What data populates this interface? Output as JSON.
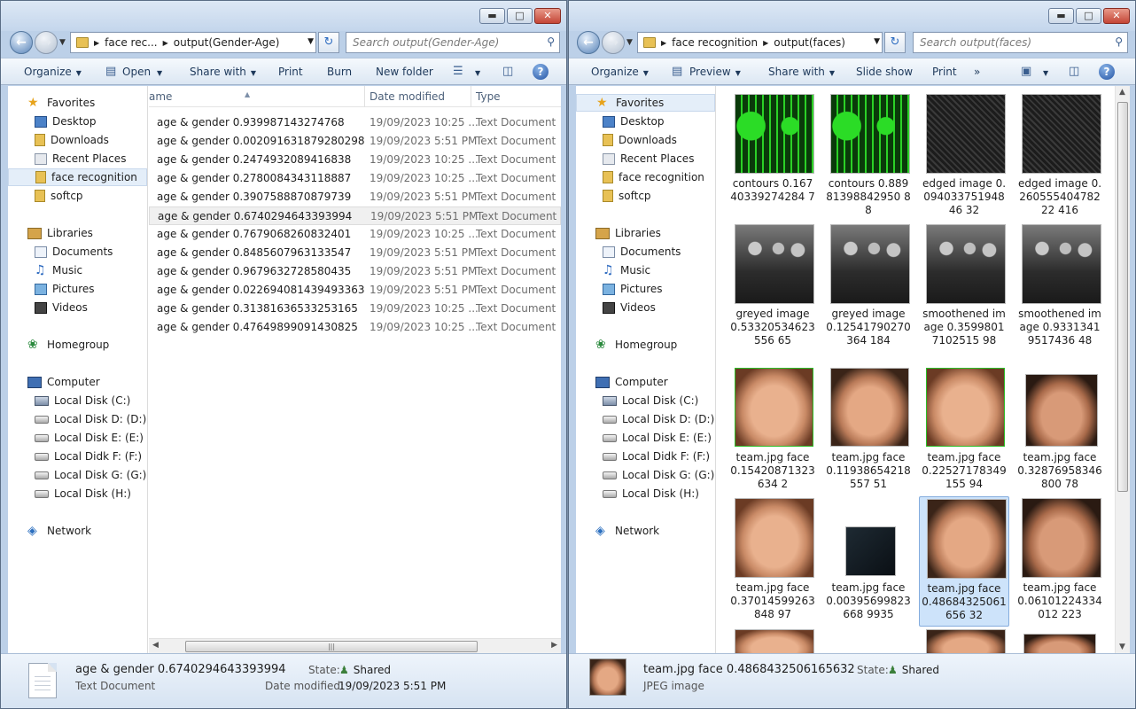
{
  "left": {
    "address": {
      "seg1": "face rec...",
      "seg2": "output(Gender-Age)"
    },
    "search_placeholder": "Search output(Gender-Age)",
    "toolbar": {
      "organize": "Organize",
      "open": "Open",
      "share": "Share with",
      "print": "Print",
      "burn": "Burn",
      "newfolder": "New folder"
    },
    "nav": {
      "favorites": "Favorites",
      "desktop": "Desktop",
      "downloads": "Downloads",
      "recent": "Recent Places",
      "facerec": "face recognition",
      "softcp": "softcp",
      "libraries": "Libraries",
      "documents": "Documents",
      "music": "Music",
      "pictures": "Pictures",
      "videos": "Videos",
      "homegroup": "Homegroup",
      "computer": "Computer",
      "diskc": "Local Disk (C:)",
      "diskd": "Local Disk D: (D:)",
      "diske": "Local Disk E: (E:)",
      "diskf": "Local Didk F: (F:)",
      "diskg": "Local Disk G: (G:)",
      "diskh": "Local Disk (H:)",
      "network": "Network"
    },
    "columns": {
      "name": "ame",
      "date": "Date modified",
      "type": "Type"
    },
    "files": [
      {
        "name": "age & gender 0.939987143274768",
        "date": "19/09/2023 10:25 ...",
        "type": "Text Document"
      },
      {
        "name": "age & gender 0.002091631879280298",
        "date": "19/09/2023 5:51 PM",
        "type": "Text Document"
      },
      {
        "name": "age & gender 0.2474932089416838",
        "date": "19/09/2023 10:25 ...",
        "type": "Text Document"
      },
      {
        "name": "age & gender 0.2780084343118887",
        "date": "19/09/2023 10:25 ...",
        "type": "Text Document"
      },
      {
        "name": "age & gender 0.3907588870879739",
        "date": "19/09/2023 5:51 PM",
        "type": "Text Document"
      },
      {
        "name": "age & gender 0.6740294643393994",
        "date": "19/09/2023 5:51 PM",
        "type": "Text Document"
      },
      {
        "name": "age & gender 0.7679068260832401",
        "date": "19/09/2023 10:25 ...",
        "type": "Text Document"
      },
      {
        "name": "age & gender 0.8485607963133547",
        "date": "19/09/2023 5:51 PM",
        "type": "Text Document"
      },
      {
        "name": "age & gender 0.9679632728580435",
        "date": "19/09/2023 5:51 PM",
        "type": "Text Document"
      },
      {
        "name": "age & gender 0.022694081439493363",
        "date": "19/09/2023 5:51 PM",
        "type": "Text Document"
      },
      {
        "name": "age & gender 0.31381636533253165",
        "date": "19/09/2023 10:25 ...",
        "type": "Text Document"
      },
      {
        "name": "age & gender 0.47649899091430825",
        "date": "19/09/2023 10:25 ...",
        "type": "Text Document"
      }
    ],
    "details": {
      "name": "age & gender 0.6740294643393994",
      "type": "Text Document",
      "state_label": "State:",
      "state": "Shared",
      "date_label": "Date modified:",
      "date": "19/09/2023 5:51 PM"
    }
  },
  "right": {
    "address": {
      "seg1": "face recognition",
      "seg2": "output(faces)"
    },
    "search_placeholder": "Search output(faces)",
    "toolbar": {
      "organize": "Organize",
      "preview": "Preview",
      "share": "Share with",
      "slideshow": "Slide show",
      "print": "Print",
      "more": "»"
    },
    "nav": {
      "favorites": "Favorites",
      "desktop": "Desktop",
      "downloads": "Downloads",
      "recent": "Recent Places",
      "facerec": "face recognition",
      "softcp": "softcp",
      "libraries": "Libraries",
      "documents": "Documents",
      "music": "Music",
      "pictures": "Pictures",
      "videos": "Videos",
      "homegroup": "Homegroup",
      "computer": "Computer",
      "diskc": "Local Disk (C:)",
      "diskd": "Local Disk D: (D:)",
      "diske": "Local Disk E: (E:)",
      "diskf": "Local Didk F: (F:)",
      "diskg": "Local Disk G: (G:)",
      "diskh": "Local Disk (H:)",
      "network": "Network"
    },
    "tiles": [
      {
        "label": "contours 0.16740339274284 7"
      },
      {
        "label": "contours 0.88981398842950 88"
      },
      {
        "label": "edged image 0.09403375194846 32"
      },
      {
        "label": "edged image 0.26055540478222 416"
      },
      {
        "label": "greyed image 0.53320534623556 65"
      },
      {
        "label": "greyed image 0.12541790270364 184"
      },
      {
        "label": "smoothened image 0.35998017102515 98"
      },
      {
        "label": "smoothened image 0.93313419517436 48"
      },
      {
        "label": "team.jpg face 0.15420871323634 2"
      },
      {
        "label": "team.jpg face 0.11938654218557 51"
      },
      {
        "label": "team.jpg face 0.22527178349155 94"
      },
      {
        "label": "team.jpg face 0.32876958346800 78"
      },
      {
        "label": "team.jpg face 0.37014599263848 97"
      },
      {
        "label": "team.jpg face 0.00395699823668 9935"
      },
      {
        "label": "team.jpg face 0.48684325061656 32"
      },
      {
        "label": "team.jpg face 0.06101224334012 223"
      }
    ],
    "details": {
      "name": "team.jpg face 0.4868432506165632",
      "type": "JPEG image",
      "state_label": "State:",
      "state": "Shared"
    }
  }
}
